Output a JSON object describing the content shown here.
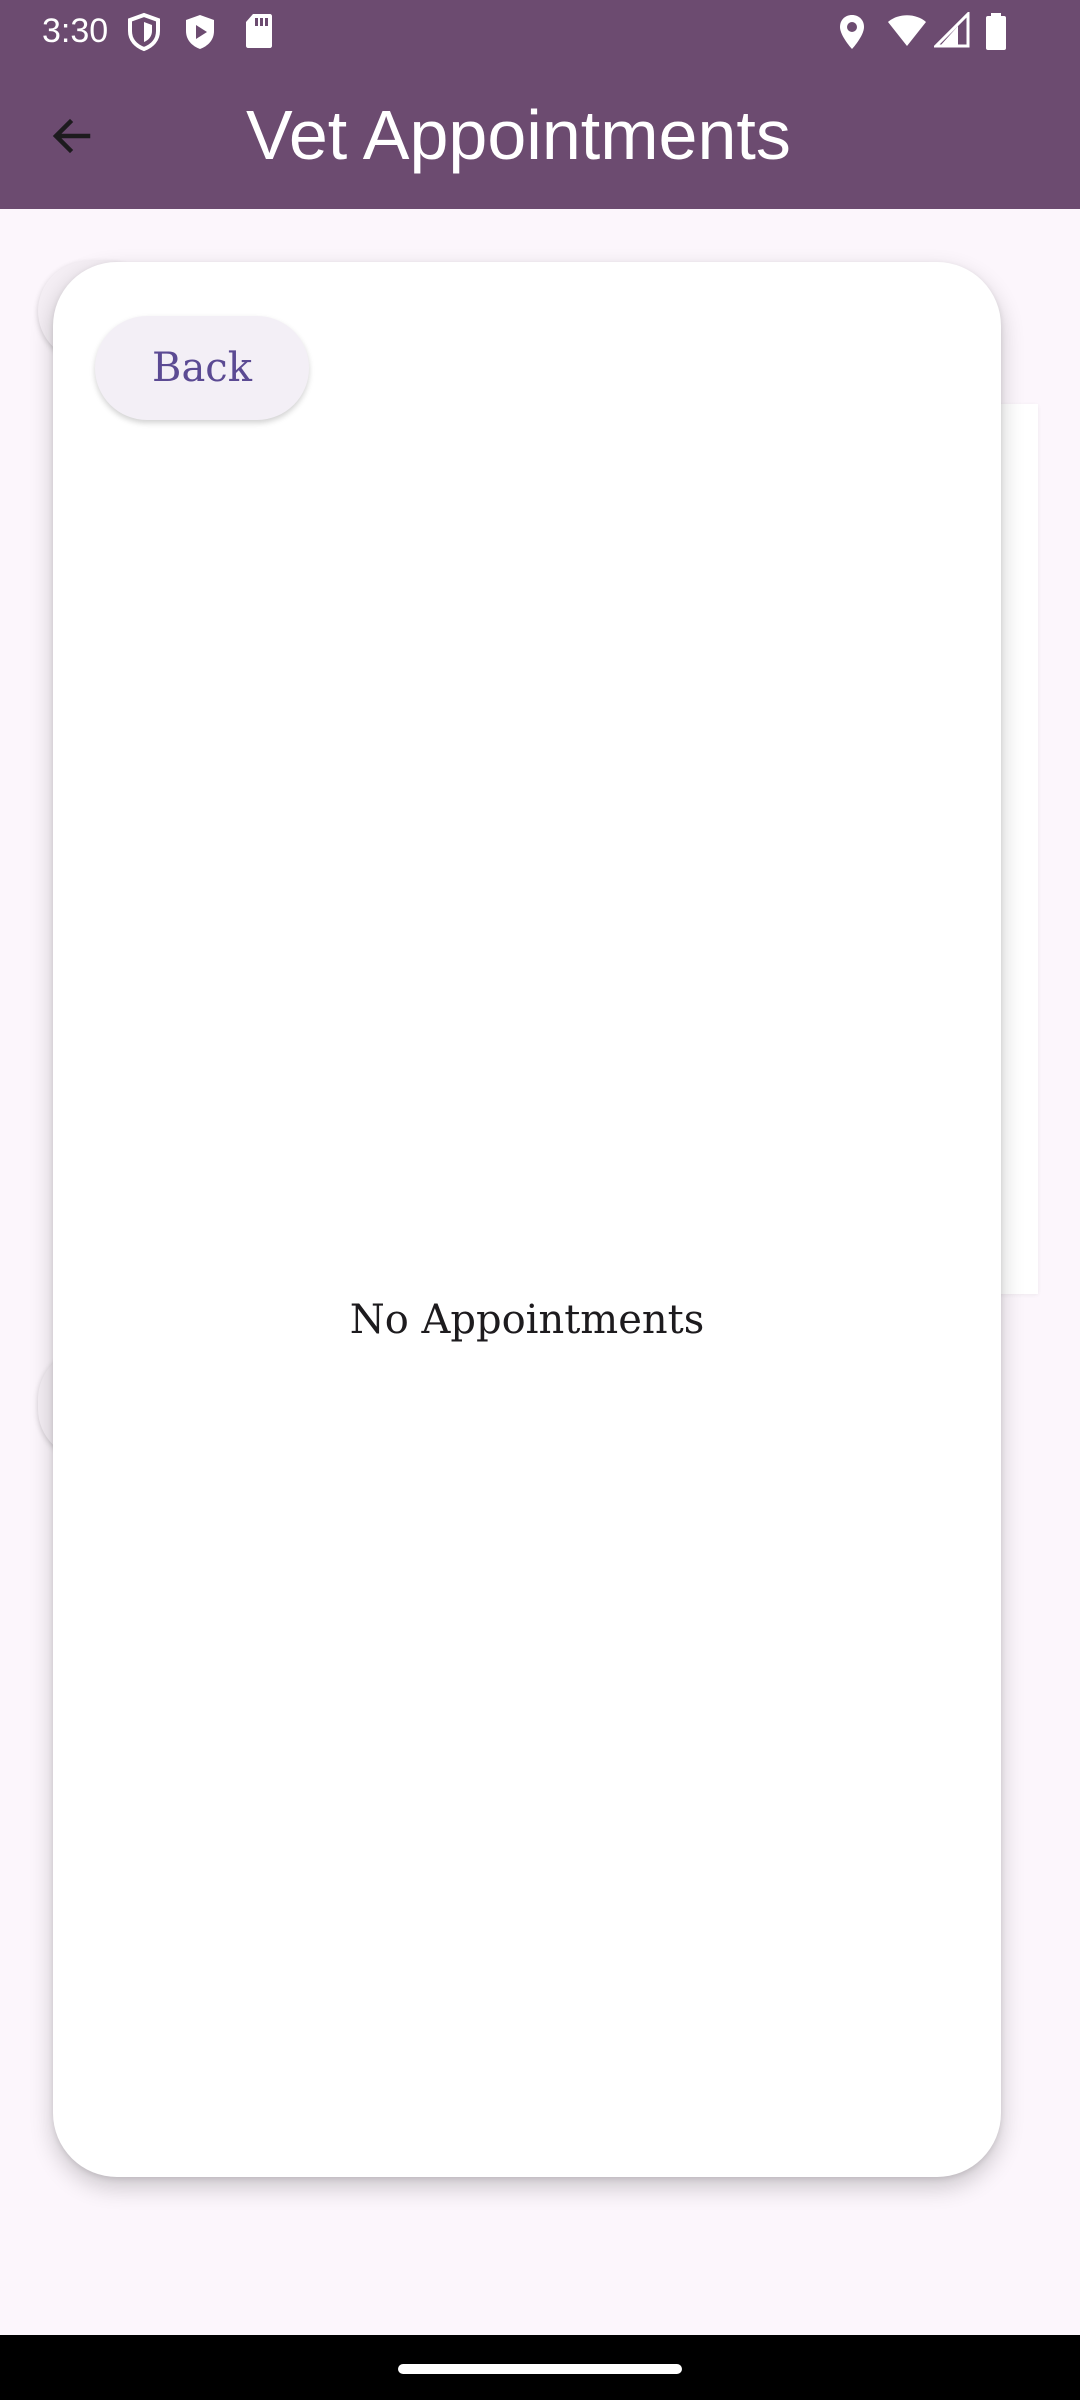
{
  "status_bar": {
    "time": "3:30",
    "icons": [
      "shield-icon",
      "play-shield-icon",
      "sd-card-icon",
      "location-icon",
      "wifi-icon",
      "signal-icon",
      "battery-icon"
    ]
  },
  "app_bar": {
    "title": "Vet Appointments",
    "back_icon": "arrow-back-icon"
  },
  "dialog": {
    "back_label": "Back",
    "empty_message": "No Appointments"
  },
  "colors": {
    "app_bar": "#6c4b70",
    "background": "#fcf6fc",
    "button_text": "#5b4a93"
  }
}
